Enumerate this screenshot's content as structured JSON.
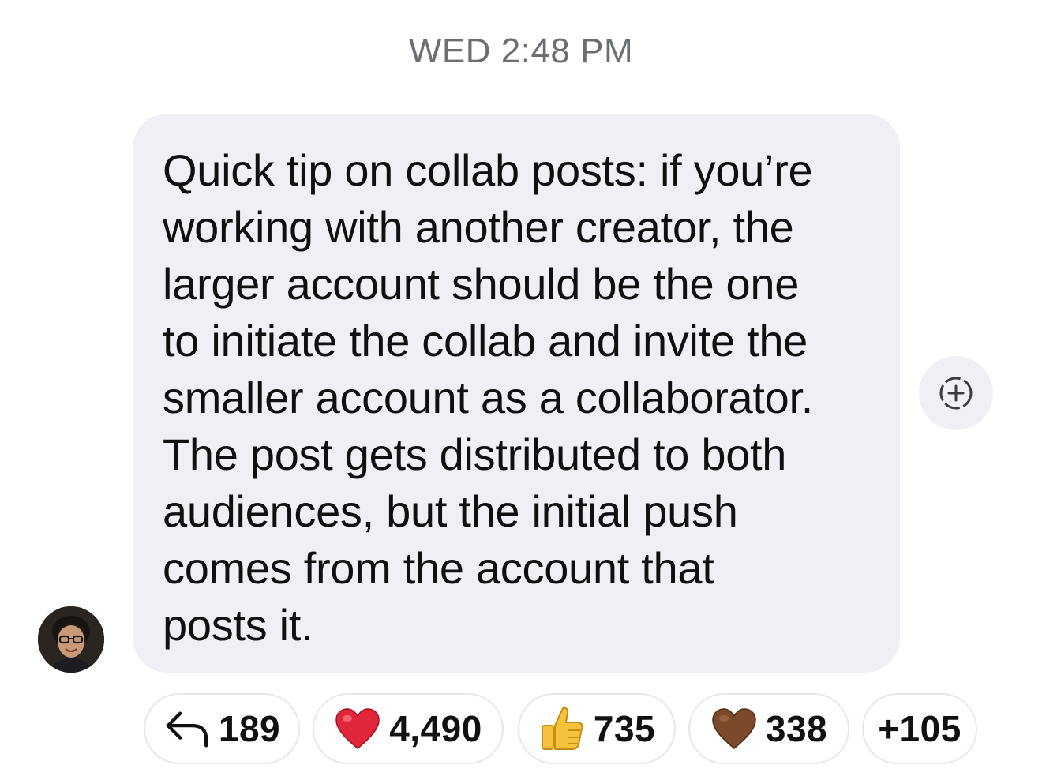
{
  "header": {
    "timestamp": "WED 2:48 PM"
  },
  "message": {
    "text": "Quick tip on collab posts: if you’re\nworking with another creator, the\nlarger account should be the one\nto initiate the collab and invite the\nsmaller account as a collaborator.\nThe post gets distributed to both\naudiences, but the initial push\ncomes from the account that\nposts it.",
    "avatar_icon": "person-avatar",
    "bubble_color": "#eef0f5"
  },
  "add_reaction": {
    "icon": "add-reaction-icon"
  },
  "reactions": [
    {
      "icon": "reply-arrow-icon",
      "count": "189"
    },
    {
      "icon": "red-heart-icon",
      "count": "4,490",
      "color": "#e0263b"
    },
    {
      "icon": "thumbs-up-icon",
      "count": "735",
      "color": "#f7c23b"
    },
    {
      "icon": "brown-heart-icon",
      "count": "338",
      "color": "#7a4a2a"
    },
    {
      "icon": "",
      "count": "+105"
    }
  ]
}
